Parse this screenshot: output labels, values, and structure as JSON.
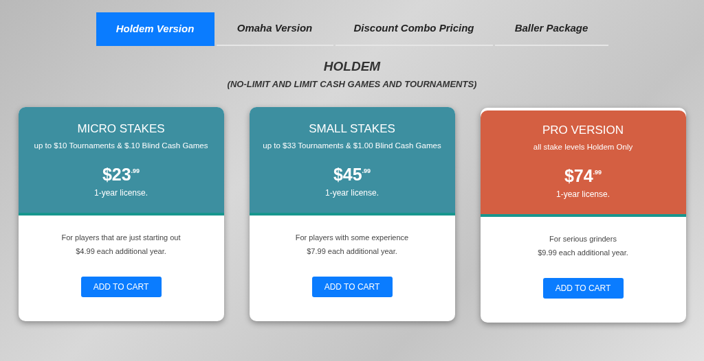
{
  "tabs": [
    {
      "label": "Holdem Version",
      "selected": true
    },
    {
      "label": "Omaha Version",
      "selected": false
    },
    {
      "label": "Discount Combo Pricing",
      "selected": false
    },
    {
      "label": "Baller Package",
      "selected": false
    }
  ],
  "heading": {
    "title": "HOLDEM",
    "subtitle": "(NO-LIMIT AND LIMIT CASH GAMES AND TOURNAMENTS)"
  },
  "plans": [
    {
      "name": "MICRO STAKES",
      "description": "up to $10 Tournaments & $.10 Blind Cash Games",
      "price": "$23$^{.99}$",
      "term": "1-year license.",
      "audience": "For players that are just starting out",
      "renewal": "$4.99 each additional year.",
      "button": "ADD TO CART",
      "color": "#3d8fa0",
      "featured": false
    },
    {
      "name": "SMALL STAKES",
      "description": "up to $33 Tournaments & $1.00 Blind Cash Games",
      "price": "$45$^{.99}$",
      "term": "1-year license.",
      "audience": "For players with some experience",
      "renewal": "$7.99 each additional year.",
      "button": "ADD TO CART",
      "color": "#3d8fa0",
      "featured": false
    },
    {
      "name": "PRO VERSION",
      "description": "all stake levels Holdem Only",
      "price": "$74$^{.99}$",
      "term": "1-year license.",
      "audience": "For serious grinders",
      "renewal": "$9.99 each additional year.",
      "button": "ADD TO CART",
      "color": "#d45f42",
      "featured": true
    }
  ]
}
